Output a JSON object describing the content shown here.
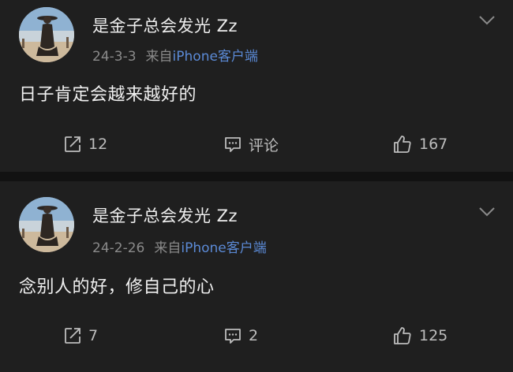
{
  "colors": {
    "background": "#1f1f1f",
    "separator": "#121212",
    "text_primary": "#ededed",
    "text_secondary": "#8a8a8a",
    "link_blue": "#5b8ad6",
    "icon_gray": "#bdbdbd"
  },
  "posts": [
    {
      "username": "是金子总会发光 Zz",
      "date": "24-3-3",
      "source_prefix": "来自",
      "source": "iPhone客户端",
      "content": "日子肯定会越来越好的",
      "reposts": "12",
      "comments": "评论",
      "likes": "167",
      "icons": {
        "menu": "chevron-down-icon",
        "repost": "share-icon",
        "comment": "comment-icon",
        "like": "thumbs-up-icon"
      }
    },
    {
      "username": "是金子总会发光 Zz",
      "date": "24-2-26",
      "source_prefix": "来自",
      "source": "iPhone客户端",
      "content": "念别人的好，修自己的心",
      "reposts": "7",
      "comments": "2",
      "likes": "125",
      "icons": {
        "menu": "chevron-down-icon",
        "repost": "share-icon",
        "comment": "comment-icon",
        "like": "thumbs-up-icon"
      }
    }
  ]
}
